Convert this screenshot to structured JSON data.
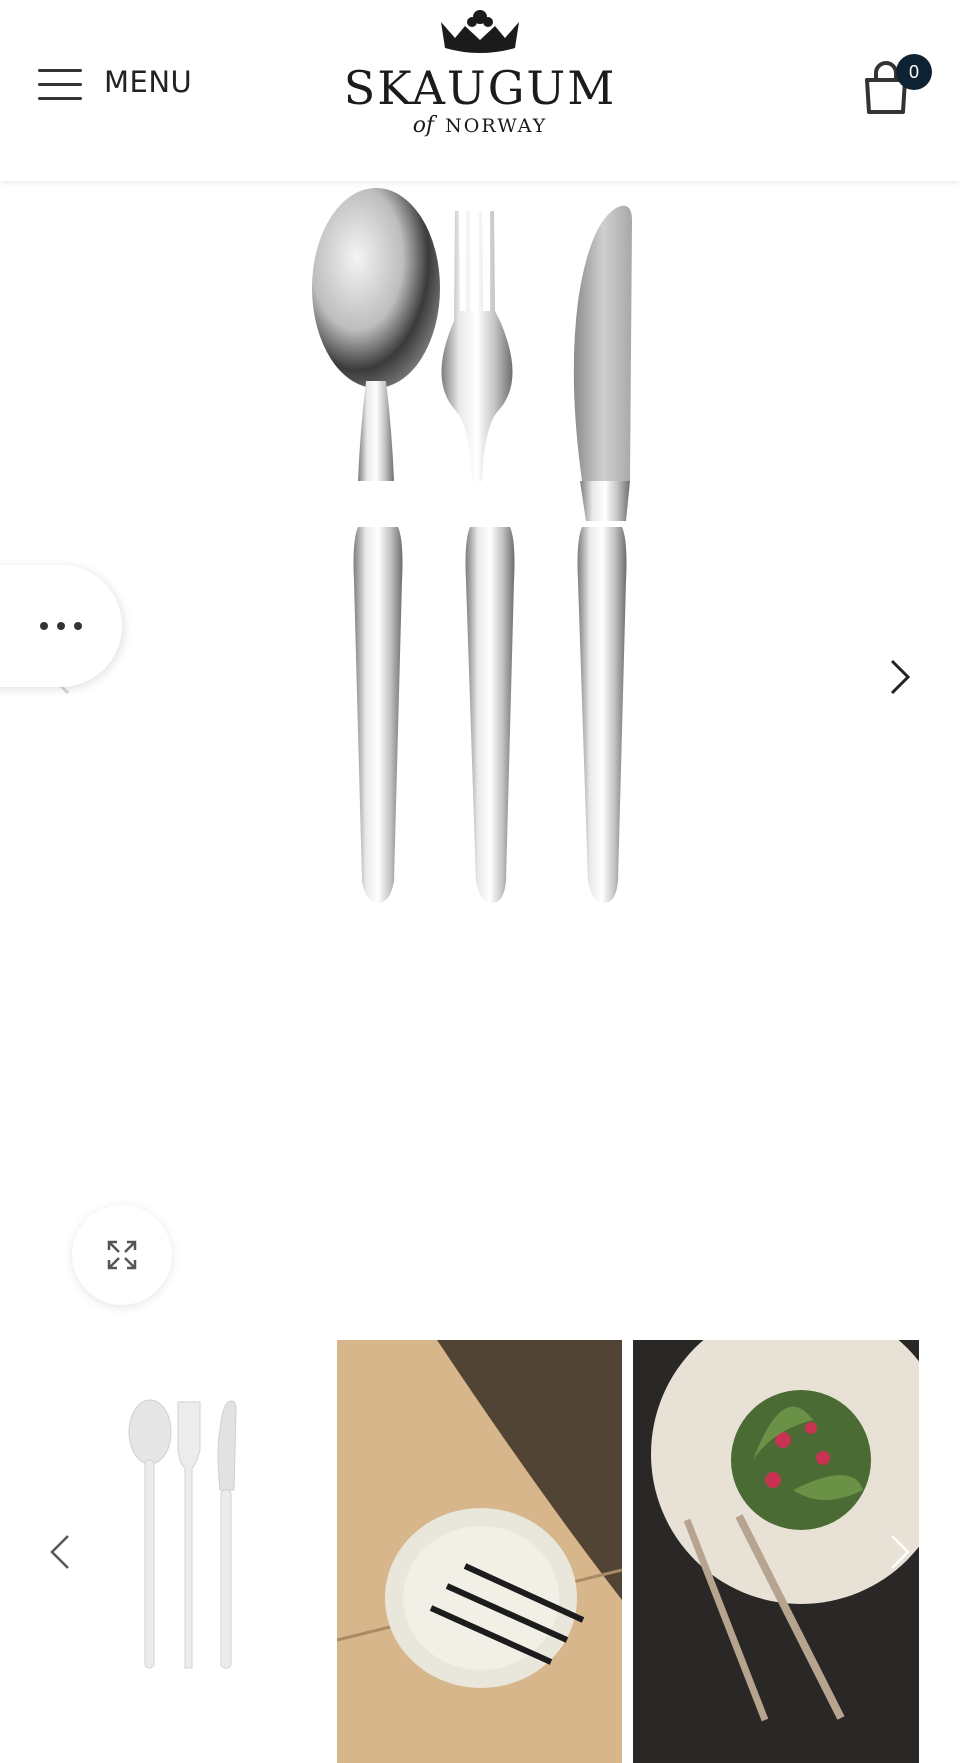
{
  "header": {
    "menu_label": "MENU",
    "logo_title": "SKAUGUM",
    "logo_of": "of",
    "logo_country": "NORWAY",
    "cart_count": "0",
    "icons": {
      "menu": "hamburger-icon",
      "cart": "shopping-bag-icon",
      "logo": "crown-icon"
    }
  },
  "gallery": {
    "icons": {
      "prev": "chevron-left-icon",
      "next": "chevron-right-icon",
      "more": "more-dots-icon",
      "expand": "expand-icon"
    }
  },
  "colors": {
    "badge": "#0f2233",
    "text": "#222222"
  }
}
